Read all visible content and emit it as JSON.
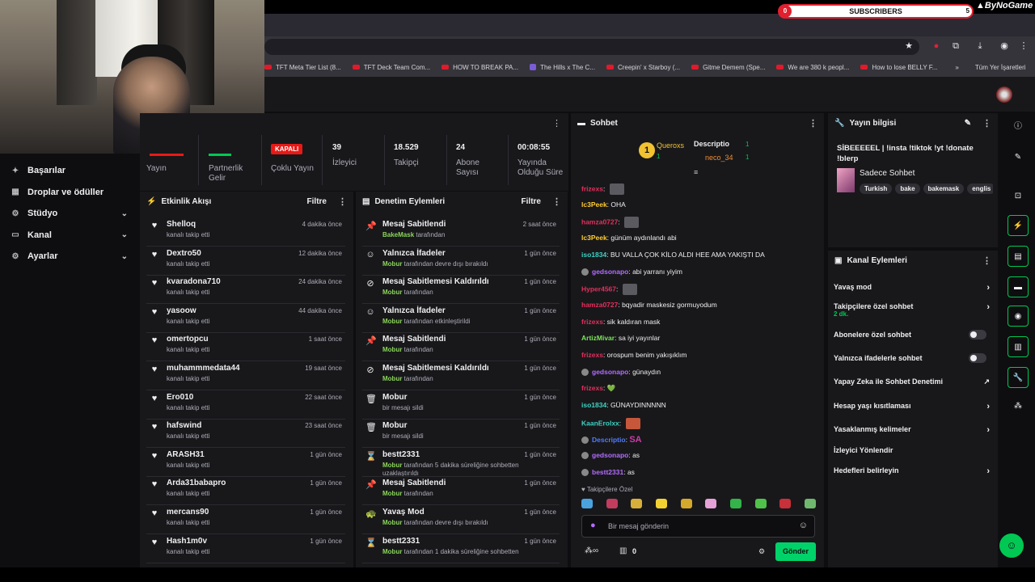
{
  "overlay": {
    "subscribers_label": "SUBSCRIBERS",
    "subscribers_current": "0",
    "subscribers_goal": "5",
    "brand": "ByNoGame"
  },
  "bookmarks": [
    "TFT Meta Tier List (8...",
    "TFT Deck Team Com...",
    "HOW TO BREAK PA...",
    "The Hills x The C...",
    "Creepin' x Starboy (...",
    "Gitme Demem (Spe...",
    "We are 380 k peopl...",
    "How to lose BELLY F...",
    "»",
    "Tüm Yer İşaretleri"
  ],
  "nav": {
    "items": [
      {
        "label": "Başarılar"
      },
      {
        "label": "Droplar ve ödüller"
      },
      {
        "label": "Stüdyo"
      },
      {
        "label": "Kanal"
      },
      {
        "label": "Ayarlar"
      }
    ]
  },
  "stats": {
    "yayin": "Yayın",
    "partner": "Partnerlik Gelir",
    "kapali": "KAPALI",
    "coklu": "Çoklu Yayın",
    "viewers": {
      "value": "39",
      "label": "İzleyici"
    },
    "followers": {
      "value": "18.529",
      "label": "Takipçi"
    },
    "subs": {
      "value": "24",
      "label": "Abone Sayısı"
    },
    "uptime": {
      "value": "00:08:55",
      "label": "Yayında Olduğu Süre"
    }
  },
  "activity": {
    "title": "Etkinlik Akışı",
    "filter": "Filtre",
    "sub": "kanalı takip etti",
    "items": [
      {
        "name": "Shelloq",
        "time": "4 dakika önce"
      },
      {
        "name": "Dextro50",
        "time": "12 dakika önce"
      },
      {
        "name": "kvaradona710",
        "time": "24 dakika önce"
      },
      {
        "name": "yasoow",
        "time": "44 dakika önce"
      },
      {
        "name": "omertopcu",
        "time": "1 saat önce"
      },
      {
        "name": "muhammmedata44",
        "time": "19 saat önce"
      },
      {
        "name": "Ero010",
        "time": "22 saat önce"
      },
      {
        "name": "hafswind",
        "time": "23 saat önce"
      },
      {
        "name": "ARASH31",
        "time": "1 gün önce"
      },
      {
        "name": "Arda31babapro",
        "time": "1 gün önce"
      },
      {
        "name": "mercans90",
        "time": "1 gün önce"
      },
      {
        "name": "Hash1m0v",
        "time": "1 gün önce"
      }
    ]
  },
  "moderation": {
    "title": "Denetim Eylemleri",
    "filter": "Filtre",
    "items": [
      {
        "icon": "📌",
        "name": "Mesaj Sabitlendi",
        "time": "2 saat önce",
        "actor": "BakeMask",
        "desc": " tarafından"
      },
      {
        "icon": "☺",
        "name": "Yalnızca İfadeler",
        "time": "1 gün önce",
        "actor": "Mobur",
        "desc": " tarafından devre dışı bırakıldı"
      },
      {
        "icon": "⊘",
        "name": "Mesaj Sabitlemesi Kaldırıldı",
        "time": "1 gün önce",
        "actor": "Mobur",
        "desc": " tarafından"
      },
      {
        "icon": "☺",
        "name": "Yalnızca İfadeler",
        "time": "1 gün önce",
        "actor": "Mobur",
        "desc": " tarafından etkinleştirildi"
      },
      {
        "icon": "📌",
        "name": "Mesaj Sabitlendi",
        "time": "1 gün önce",
        "actor": "Mobur",
        "desc": " tarafından"
      },
      {
        "icon": "⊘",
        "name": "Mesaj Sabitlemesi Kaldırıldı",
        "time": "1 gün önce",
        "actor": "Mobur",
        "desc": " tarafından"
      },
      {
        "icon": "🗑",
        "name": "Mobur",
        "time": "1 gün önce",
        "actor": "",
        "desc": "bir mesajı sildi"
      },
      {
        "icon": "🗑",
        "name": "Mobur",
        "time": "1 gün önce",
        "actor": "",
        "desc": "bir mesajı sildi"
      },
      {
        "icon": "⌛",
        "name": "bestt2331",
        "time": "1 gün önce",
        "actor": "Mobur",
        "desc": " tarafından 5 dakika süreliğine sohbetten uzaklaştırıldı"
      },
      {
        "icon": "📌",
        "name": "Mesaj Sabitlendi",
        "time": "1 gün önce",
        "actor": "Mobur",
        "desc": " tarafından"
      },
      {
        "icon": "🐢",
        "name": "Yavaş Mod",
        "time": "1 gün önce",
        "actor": "Mobur",
        "desc": " tarafından devre dışı bırakıldı"
      },
      {
        "icon": "⌛",
        "name": "bestt2331",
        "time": "1 gün önce",
        "actor": "Mobur",
        "desc": " tarafından 1 dakika süreliğine sohbetten"
      }
    ]
  },
  "chat": {
    "title": "Sohbet",
    "leaders": [
      {
        "name": "Queroxs",
        "count": "1"
      },
      {
        "name": "Descriptio",
        "count": "1"
      },
      {
        "name": "neco_34",
        "count": "1"
      }
    ],
    "messages": [
      {
        "user": "frizexs",
        "color": "#e2305b",
        "text": "",
        "emote": true
      },
      {
        "user": "lc3Peek",
        "color": "#ffcc33",
        "text": "OHA",
        "emote": false
      },
      {
        "user": "hamza0727",
        "color": "#e2305b",
        "text": "",
        "emote": true
      },
      {
        "user": "lc3Peek",
        "color": "#ffcc33",
        "text": "günüm aydınlandı abi",
        "emote": false
      },
      {
        "user": "iso1834",
        "color": "#3fd1c2",
        "text": "BU VALLA ÇOK KİLO ALDI HEE AMA YAKIŞTI DA",
        "emote": false
      },
      {
        "user": "gedsonapo",
        "color": "#b46cff",
        "text": "abi yarranı yiyim",
        "emote": false
      },
      {
        "user": "Hyper4567",
        "color": "#e2305b",
        "text": "",
        "emote": true
      },
      {
        "user": "hamza0727",
        "color": "#e2305b",
        "text": "bqyadir maskesiz gormuyodum",
        "emote": false
      },
      {
        "user": "frizexs",
        "color": "#e2305b",
        "text": "sik kaldıran mask",
        "emote": false
      },
      {
        "user": "ArtizMivar",
        "color": "#7be35a",
        "text": "sa iyi yayınlar",
        "emote": false
      },
      {
        "user": "frizexs",
        "color": "#e2305b",
        "text": "orospum benim yakışıklım",
        "emote": false
      },
      {
        "user": "gedsonapo",
        "color": "#b46cff",
        "text": "günaydın",
        "emote": false
      },
      {
        "user": "frizexs",
        "color": "#e2305b",
        "text": "💚",
        "emote": false
      },
      {
        "user": "iso1834",
        "color": "#3fd1c2",
        "text": "GÜNAYDINNNNN",
        "emote": false
      },
      {
        "user": "KaanErolxx",
        "color": "#3fd1c2",
        "text": "",
        "emote": true
      },
      {
        "user": "Descriptio",
        "color": "#4f7bff",
        "text": "SA",
        "emote": false
      },
      {
        "user": "gedsonapo",
        "color": "#b46cff",
        "text": "as",
        "emote": false
      },
      {
        "user": "bestt2331",
        "color": "#b46cff",
        "text": "as",
        "emote": false
      }
    ],
    "followers_only": "Takipçilere Özel",
    "placeholder": "Bir mesaj gönderin",
    "points": "0",
    "send": "Gönder"
  },
  "stream_info": {
    "title": "Yayın bilgisi",
    "stream_title": "SİBEEEEEL | !insta !tiktok !yt !donate !blerp",
    "category": "Sadece Sohbet",
    "tags": [
      "Turkish",
      "bake",
      "bakemask",
      "englis"
    ]
  },
  "channel_actions": {
    "title": "Kanal Eylemleri",
    "items": [
      {
        "label": "Yavaş mod",
        "kind": "chev",
        "sub": ""
      },
      {
        "label": "Takipçilere özel sohbet",
        "kind": "chev",
        "sub": "2 dk."
      },
      {
        "label": "Abonelere özel sohbet",
        "kind": "toggle",
        "sub": ""
      },
      {
        "label": "Yalnızca ifadelerle sohbet",
        "kind": "toggle",
        "sub": ""
      },
      {
        "label": "Yapay Zeka ile Sohbet Denetimi",
        "kind": "ext",
        "sub": ""
      },
      {
        "label": "Hesap yaşı kısıtlaması",
        "kind": "chev",
        "sub": ""
      },
      {
        "label": "Yasaklanmış kelimeler",
        "kind": "chev",
        "sub": ""
      },
      {
        "label": "İzleyici Yönlendir",
        "kind": "none",
        "sub": ""
      },
      {
        "label": "Hedefleri belirleyin",
        "kind": "chev",
        "sub": ""
      }
    ]
  },
  "colors": {
    "accent": "#00c853",
    "live_red": "#e91916",
    "panel": "#18181b"
  }
}
